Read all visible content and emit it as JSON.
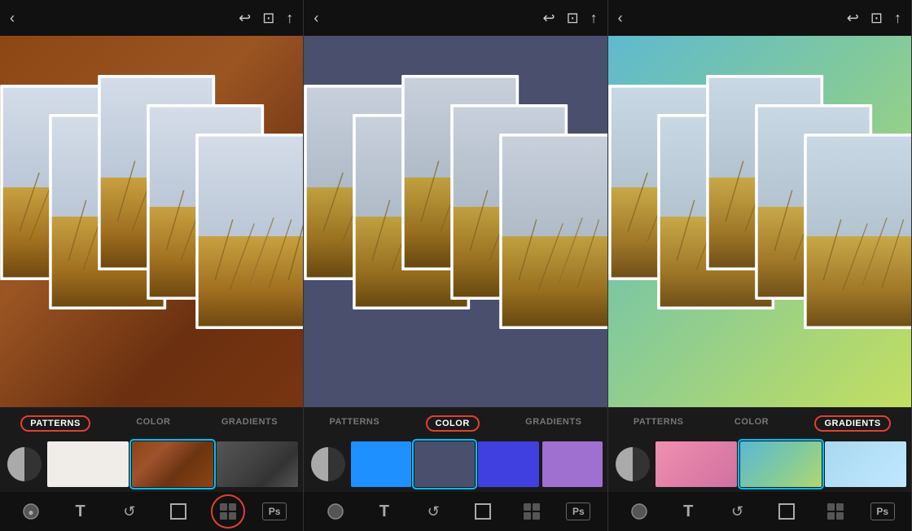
{
  "panels": [
    {
      "id": "panel-1",
      "bg_color": "#7a4520",
      "active_tab": "PATTERNS",
      "tabs": [
        {
          "label": "PATTERNS",
          "active": true,
          "highlighted": true
        },
        {
          "label": "COLOR",
          "active": false,
          "highlighted": false
        },
        {
          "label": "GRADIENTS",
          "active": false,
          "highlighted": false
        }
      ],
      "thumbs": [
        {
          "type": "circle"
        },
        {
          "type": "white",
          "selected": false
        },
        {
          "type": "rust",
          "selected": true
        },
        {
          "type": "dark",
          "selected": false
        }
      ],
      "bottom_tools": [
        "circle",
        "T",
        "undo",
        "frame",
        "dots",
        "ps"
      ]
    },
    {
      "id": "panel-2",
      "bg_color": "#4a4f6e",
      "active_tab": "COLOR",
      "tabs": [
        {
          "label": "PATTERNS",
          "active": false,
          "highlighted": false
        },
        {
          "label": "COLOR",
          "active": true,
          "highlighted": true
        },
        {
          "label": "GRADIENTS",
          "active": false,
          "highlighted": false
        }
      ],
      "thumbs": [
        {
          "type": "circle"
        },
        {
          "type": "blue-medium",
          "selected": false
        },
        {
          "type": "slate",
          "selected": true
        },
        {
          "type": "bright-blue",
          "selected": false
        },
        {
          "type": "lavender",
          "selected": false
        }
      ],
      "bottom_tools": [
        "circle",
        "T",
        "undo",
        "frame",
        "dots",
        "ps"
      ]
    },
    {
      "id": "panel-3",
      "bg_color": "#b8d870",
      "active_tab": "GRADIENTS",
      "tabs": [
        {
          "label": "PATTERNS",
          "active": false,
          "highlighted": false
        },
        {
          "label": "COLOR",
          "active": false,
          "highlighted": false
        },
        {
          "label": "GRADIENTS",
          "active": true,
          "highlighted": true
        }
      ],
      "thumbs": [
        {
          "type": "circle"
        },
        {
          "type": "pink-grad",
          "selected": false
        },
        {
          "type": "blue-green-grad",
          "selected": true
        },
        {
          "type": "light-blue-grad",
          "selected": false
        }
      ],
      "bottom_tools": [
        "circle",
        "T",
        "undo",
        "frame",
        "dots",
        "ps"
      ]
    }
  ],
  "top_bar": {
    "back_icon": "‹",
    "undo_icon": "↩",
    "frame_icon": "⊡",
    "share_icon": "⬆"
  }
}
